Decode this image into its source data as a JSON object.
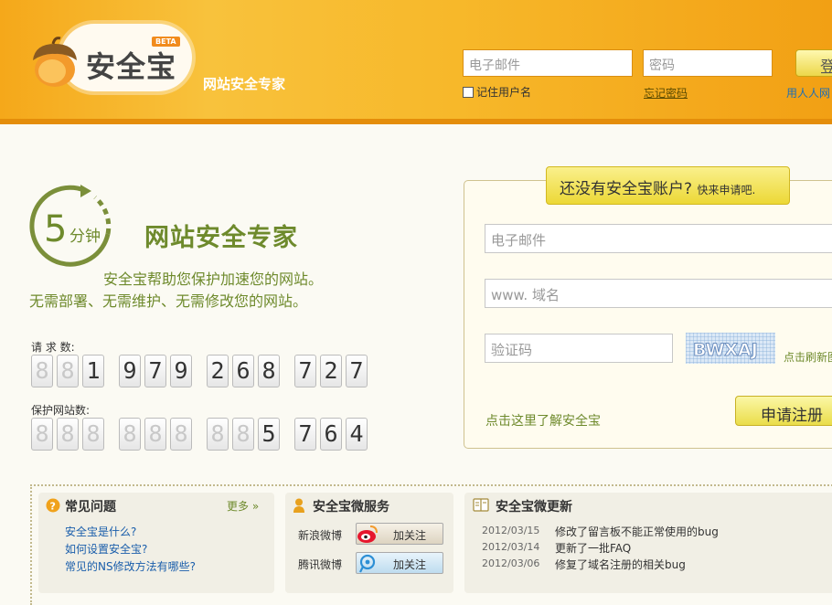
{
  "header": {
    "logo_text": "安全宝",
    "beta": "BETA",
    "slogan": "网站安全专家",
    "email_placeholder": "电子邮件",
    "password_placeholder": "密码",
    "login_button": "登",
    "remember_label": "记住用户名",
    "forgot_link": "忘记密码",
    "renren_link": "用人人网"
  },
  "intro": {
    "clock_number": "5",
    "clock_unit": "分钟",
    "title": "网站安全专家",
    "line1": "安全宝帮助您保护加速您的网站。",
    "line2": "无需部署、无需维护、无需修改您的网站。"
  },
  "counters": {
    "requests": {
      "label": "请  求  数:",
      "digits": [
        "8",
        "8",
        "1",
        "9",
        "7",
        "9",
        "2",
        "6",
        "8",
        "7",
        "2",
        "7"
      ],
      "active": [
        false,
        false,
        true,
        true,
        true,
        true,
        true,
        true,
        true,
        true,
        true,
        true
      ]
    },
    "sites": {
      "label": "保护网站数:",
      "digits": [
        "8",
        "8",
        "8",
        "8",
        "8",
        "8",
        "8",
        "8",
        "5",
        "7",
        "6",
        "4"
      ],
      "active": [
        false,
        false,
        false,
        false,
        false,
        false,
        false,
        false,
        true,
        true,
        true,
        true
      ]
    }
  },
  "signup": {
    "tab_title": "还没有安全宝账户?",
    "tab_sub": "快来申请吧.",
    "email_placeholder": "电子邮件",
    "domain_placeholder": "www. 域名",
    "captcha_placeholder": "验证码",
    "captcha_text": "BWXAJ",
    "refresh_link": "点击刷新图",
    "register_button": "申请注册",
    "learn_link": "点击这里了解安全宝"
  },
  "faq": {
    "title": "常见问题",
    "more": "更多 »",
    "items": [
      "安全宝是什么?",
      "如何设置安全宝?",
      "常见的NS修改方法有哪些?"
    ]
  },
  "weibo": {
    "title": "安全宝微服务",
    "sina_label": "新浪微博",
    "qq_label": "腾讯微博",
    "follow_label": "加关注"
  },
  "updates": {
    "title": "安全宝微更新",
    "items": [
      {
        "date": "2012/03/15",
        "text": "修改了留言板不能正常使用的bug"
      },
      {
        "date": "2012/03/14",
        "text": "更新了一批FAQ"
      },
      {
        "date": "2012/03/06",
        "text": "修复了域名注册的相关bug"
      }
    ]
  },
  "colors": {
    "header_orange": "#f5a81a",
    "brand_green": "#6e8a2c",
    "button_yellow": "#ecd836",
    "link_blue": "#1a5eab"
  }
}
